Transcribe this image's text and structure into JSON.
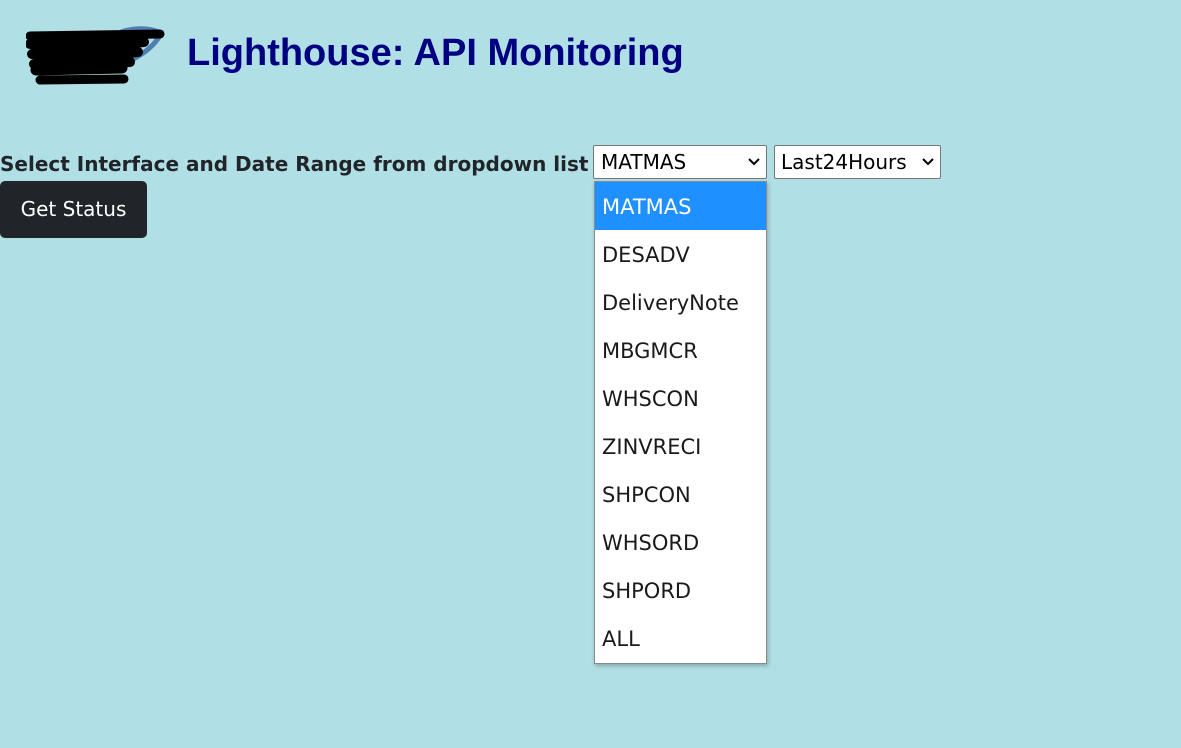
{
  "header": {
    "title": "Lighthouse: API Monitoring",
    "logo_icon": "redacted-logo"
  },
  "form": {
    "prompt_label": "Select Interface and Date Range from dropdown list",
    "interface_select": {
      "selected": "MATMAS",
      "options": [
        "MATMAS",
        "DESADV",
        "DeliveryNote",
        "MBGMCR",
        "WHSCON",
        "ZINVRECI",
        "SHPCON",
        "WHSORD",
        "SHPORD",
        "ALL"
      ],
      "expanded": true
    },
    "date_range_select": {
      "selected": "Last24Hours"
    },
    "get_status_label": "Get Status"
  },
  "colors": {
    "background": "#b0dfe5",
    "title": "#000080",
    "button_bg": "#212529",
    "highlight": "#1e90ff"
  }
}
